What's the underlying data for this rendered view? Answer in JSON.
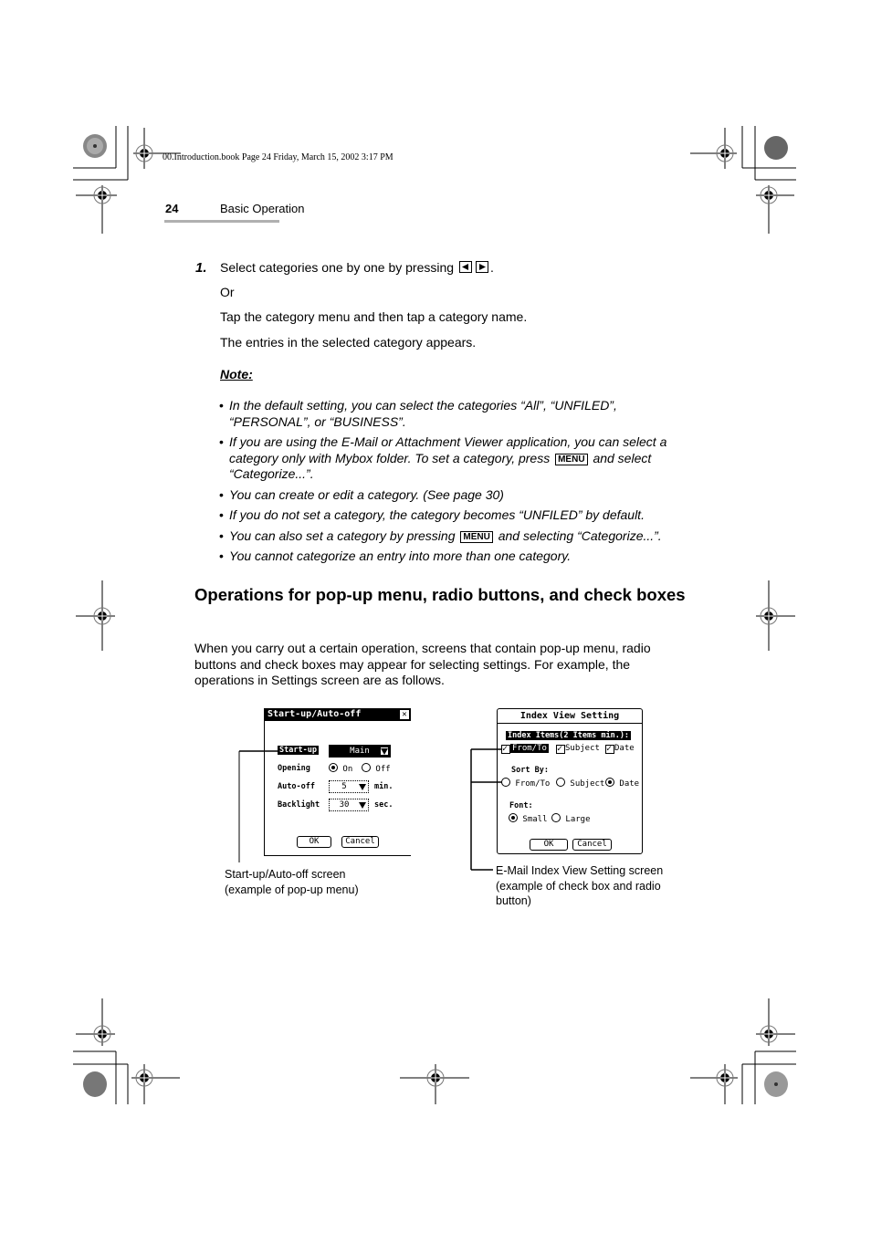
{
  "print_header": {
    "book_line": "00.Introduction.book  Page 24  Friday, March 15, 2002  3:17 PM"
  },
  "page_header": {
    "page_number": "24",
    "section_title": "Basic Operation"
  },
  "step": {
    "number": "1.",
    "line1_before": "Select categories one by one by pressing",
    "line1_after": ".",
    "left_key_icon": "left-arrow-key-icon",
    "right_key_icon": "right-arrow-key-icon",
    "or": "Or",
    "line2": "Tap the category menu and then tap a category name.",
    "line3": "The entries in the selected category appears."
  },
  "note": {
    "label": "Note:",
    "key_label": "MENU",
    "bullets": [
      {
        "text": "In the default setting, you can select the categories “All”, “UNFILED”, “PERSONAL”, or “BUSINESS”."
      },
      {
        "before": "If you are using the E-Mail or Attachment Viewer application, you can select a category only with Mybox folder. To set a category, press",
        "after": "and select “Categorize...”."
      },
      {
        "text": "You can create or edit a category. (See page 30)"
      },
      {
        "text": "If you do not set a category, the category becomes “UNFILED” by default."
      },
      {
        "before": "You can also set a category by pressing",
        "after": "and selecting “Categorize...”."
      },
      {
        "text": "You cannot categorize an entry into more than one category."
      }
    ]
  },
  "section": {
    "heading": "Operations for pop-up menu, radio buttons, and check boxes",
    "paragraph": "When you carry out a certain operation, screens that contain pop-up menu, radio buttons and check boxes may appear for selecting settings. For example, the operations in Settings screen are as follows."
  },
  "screen1": {
    "title": "Start-up/Auto-off",
    "close_icon": "close-box-icon",
    "startup_label": "Start-up",
    "startup_value": "Main",
    "opening_label": "Opening",
    "opening_on": "On",
    "opening_off": "Off",
    "opening_selected": "On",
    "autooff_label": "Auto-off",
    "autooff_value": "5",
    "autooff_unit": "min.",
    "backlight_label": "Backlight",
    "backlight_value": "30",
    "backlight_unit": "sec.",
    "ok": "OK",
    "cancel": "Cancel",
    "caption_line1": "Start-up/Auto-off screen",
    "caption_line2": "(example of pop-up menu)"
  },
  "screen2": {
    "title": "Index View Setting",
    "index_items_label": "Index Items(2 Items min.):",
    "check_fromto": "From/To",
    "check_subject": "Subject",
    "check_date": "Date",
    "checked": [
      "From/To",
      "Subject",
      "Date"
    ],
    "sortby_label": "Sort By:",
    "sort_fromto": "From/To",
    "sort_subject": "Subject",
    "sort_date": "Date",
    "sort_selected": "Date",
    "font_label": "Font:",
    "font_small": "Small",
    "font_large": "Large",
    "font_selected": "Small",
    "ok": "OK",
    "cancel": "Cancel",
    "caption_line1": "E-Mail Index View Setting screen",
    "caption_line2": "(example of check box and radio",
    "caption_line3": "button)"
  }
}
